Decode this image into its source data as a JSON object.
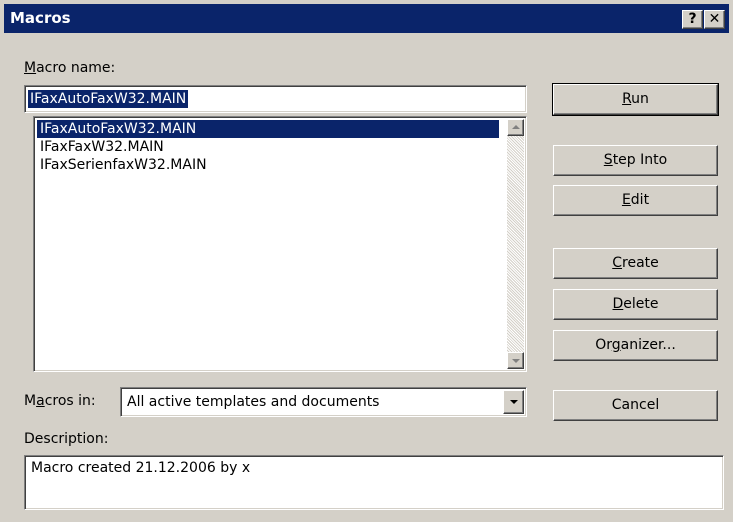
{
  "window": {
    "title": "Macros",
    "help_glyph": "?",
    "close_glyph": "✕"
  },
  "macro_name": {
    "label_accel": "M",
    "label_rest": "acro name:",
    "value": "IFaxAutoFaxW32.MAIN"
  },
  "macro_list": {
    "items": [
      "IFaxAutoFaxW32.MAIN",
      "IFaxFaxW32.MAIN",
      "IFaxSerienfaxW32.MAIN"
    ],
    "selected_index": 0
  },
  "macros_in": {
    "label_pre": "M",
    "label_accel": "a",
    "label_rest": "cros in:",
    "value": "All active templates and documents"
  },
  "description": {
    "label": "Description:",
    "text": "Macro created 21.12.2006 by x"
  },
  "buttons": {
    "run": {
      "accel": "R",
      "rest": "un"
    },
    "step_into": {
      "accel": "S",
      "rest": "tep Into"
    },
    "edit": {
      "accel": "E",
      "rest": "dit"
    },
    "create": {
      "accel": "C",
      "rest": "reate"
    },
    "delete": {
      "accel": "D",
      "rest": "elete"
    },
    "organizer": {
      "pre": "Or",
      "accel": "g",
      "rest": "anizer..."
    },
    "cancel": {
      "label": "Cancel"
    }
  },
  "icons": {
    "help": "help-icon",
    "close": "close-icon",
    "scroll_up": "arrow-up-icon",
    "scroll_down": "arrow-down-icon",
    "dropdown": "chevron-down-icon"
  },
  "colors": {
    "titlebar": "#0a246a",
    "face": "#d4d0c8",
    "selection": "#0a246a"
  }
}
